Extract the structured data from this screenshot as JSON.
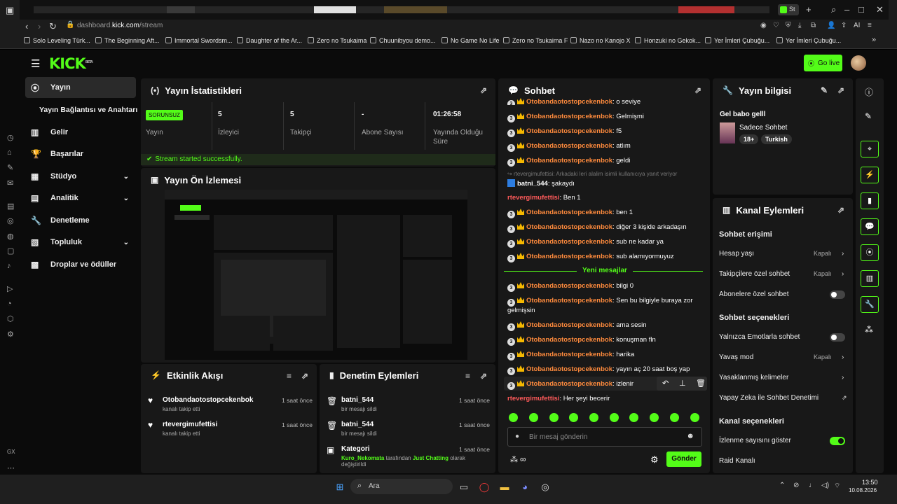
{
  "browser": {
    "tab_label": "St",
    "url_prefix": "dashboard.",
    "url_domain": "kick.com",
    "url_path": "/stream",
    "bookmarks": [
      "Solo Leveling Türk...",
      "The Beginning Aft...",
      "Immortal Swordsm...",
      "Daughter of the Ar...",
      "Zero no Tsukaima",
      "Chuunibyou demo...",
      "No Game No Life",
      "Zero no Tsukaima F",
      "Nazo no Kanojo X",
      "Honzuki no Gekok...",
      "Yer İmleri Çubuğu...",
      "Yer İmleri Çubuğu..."
    ]
  },
  "header": {
    "logo": "KICK",
    "logo_beta": "BETA",
    "go_live": "Go live"
  },
  "sidebar": {
    "items": [
      {
        "label": "Yayın",
        "icon": "broadcast-icon"
      },
      {
        "label": "Yayın Bağlantısı ve Anahtarı",
        "icon": ""
      },
      {
        "label": "Gelir",
        "icon": "chart-icon"
      },
      {
        "label": "Başarılar",
        "icon": "trophy-icon"
      },
      {
        "label": "Stüdyo",
        "icon": "studio-icon"
      },
      {
        "label": "Analitik",
        "icon": "analytics-icon"
      },
      {
        "label": "Denetleme",
        "icon": "wrench-icon"
      },
      {
        "label": "Topluluk",
        "icon": "community-icon"
      },
      {
        "label": "Droplar ve ödüller",
        "icon": "gift-icon"
      }
    ]
  },
  "stats": {
    "title": "Yayın İstatistikleri",
    "status_badge": "SORUNSUZ",
    "status_label": "Yayın",
    "viewers_value": "5",
    "viewers_label": "İzleyici",
    "followers_value": "5",
    "followers_label": "Takipçi",
    "subs_value": "-",
    "subs_label": "Abone Sayısı",
    "uptime_value": "01:26:58",
    "uptime_label": "Yayında Olduğu Süre",
    "success_msg": "Stream started successfully."
  },
  "preview": {
    "title": "Yayın Ön İzlemesi"
  },
  "activity": {
    "title": "Etkinlik Akışı",
    "events": [
      {
        "user": "Otobandaotostopcekenbok",
        "action": "kanalı takip etti",
        "time": "1 saat önce"
      },
      {
        "user": "rtevergimufettisi",
        "action": "kanalı takip etti",
        "time": "1 saat önce"
      }
    ]
  },
  "moderation": {
    "title": "Denetim Eylemleri",
    "events": [
      {
        "user": "batni_544",
        "action": "bir mesajı sildi",
        "time": "1 saat önce"
      },
      {
        "user": "batni_544",
        "action": "bir mesajı sildi",
        "time": "1 saat önce"
      }
    ],
    "category": {
      "label": "Kategori",
      "time": "1 saat önce",
      "user": "Kuro_Nekomata",
      "by": "tarafından",
      "cat": "Just Chatting",
      "suffix": "olarak",
      "line2": "değiştirildi"
    }
  },
  "chat": {
    "title": "Sohbet",
    "messages": [
      {
        "user": "Otobandaotostopcekenbok",
        "text": ": o seviye"
      },
      {
        "user": "Otobandaotostopcekenbok",
        "text": ": Gelmişmi"
      },
      {
        "user": "Otobandaotostopcekenbok",
        "text": ": f5"
      },
      {
        "user": "Otobandaotostopcekenbok",
        "text": ": atlım"
      },
      {
        "user": "Otobandaotostopcekenbok",
        "text": ": geldi"
      }
    ],
    "reply_note": "rtevergimufettisi: Arkadaki leri alalim isimli kullanıcıya yanıt veriyor",
    "batni": {
      "user": "batni_544",
      "text": ": şakaydı"
    },
    "rte1": {
      "user": "rtevergimufettisi",
      "text": ": Ben 1"
    },
    "messages2": [
      {
        "user": "Otobandaotostopcekenbok",
        "text": ": ben 1"
      },
      {
        "user": "Otobandaotostopcekenbok",
        "text": ": diğer 3 kişide arkadaşın"
      },
      {
        "user": "Otobandaotostopcekenbok",
        "text": ": sub ne kadar ya"
      },
      {
        "user": "Otobandaotostopcekenbok",
        "text": ": sub alamıyormuyuz"
      }
    ],
    "new_messages": "Yeni mesajlar",
    "messages3": [
      {
        "user": "Otobandaotostopcekenbok",
        "text": ": bilgi 0"
      },
      {
        "user": "Otobandaotostopcekenbok",
        "text": ": Sen bu bilgiyle buraya zor"
      }
    ],
    "wrap_text": "gelmişsin",
    "messages4": [
      {
        "user": "Otobandaotostopcekenbok",
        "text": ": ama sesin"
      },
      {
        "user": "Otobandaotostopcekenbok",
        "text": ": konuşman fln"
      },
      {
        "user": "Otobandaotostopcekenbok",
        "text": ": harika"
      },
      {
        "user": "Otobandaotostopcekenbok",
        "text": ": yayın aç 20 saat boş yap"
      },
      {
        "user": "Otobandaotostopcekenbok",
        "text": ": izlenir"
      }
    ],
    "rte2": {
      "user": "rtevergimufettisi",
      "text": ": Her şeyi becerir"
    },
    "badge": "3",
    "input_placeholder": "Bir mesaj gönderin",
    "send": "Gönder"
  },
  "stream_info": {
    "title": "Yayın bilgisi",
    "stream_title": "Gel babo gelll",
    "category": "Sadece Sohbet",
    "tags": [
      "18+",
      "Turkish"
    ]
  },
  "channel_actions": {
    "title": "Kanal Eylemleri",
    "chat_access": "Sohbet erişimi",
    "account_age": "Hesap yaşı",
    "account_age_val": "Kapalı",
    "followers_only": "Takipçilere özel sohbet",
    "followers_only_val": "Kapalı",
    "subs_only": "Abonelere özel sohbet",
    "chat_options": "Sohbet seçenekleri",
    "emote_only": "Yalnızca Emotlarla sohbet",
    "slow_mode": "Yavaş mod",
    "slow_mode_val": "Kapalı",
    "banned_words": "Yasaklanmış kelimeler",
    "ai_mod": "Yapay Zeka ile Sohbet Denetimi",
    "channel_options": "Kanal seçenekleri",
    "show_viewers": "İzlenme sayısını göster",
    "raid": "Raid Kanalı"
  },
  "taskbar": {
    "search": "Ara",
    "time": "13:50",
    "date": "10.08.2026"
  },
  "colors": {
    "accent": "#53fc18",
    "username": "#ff8b3d",
    "username_red": "#ff5a5a"
  }
}
